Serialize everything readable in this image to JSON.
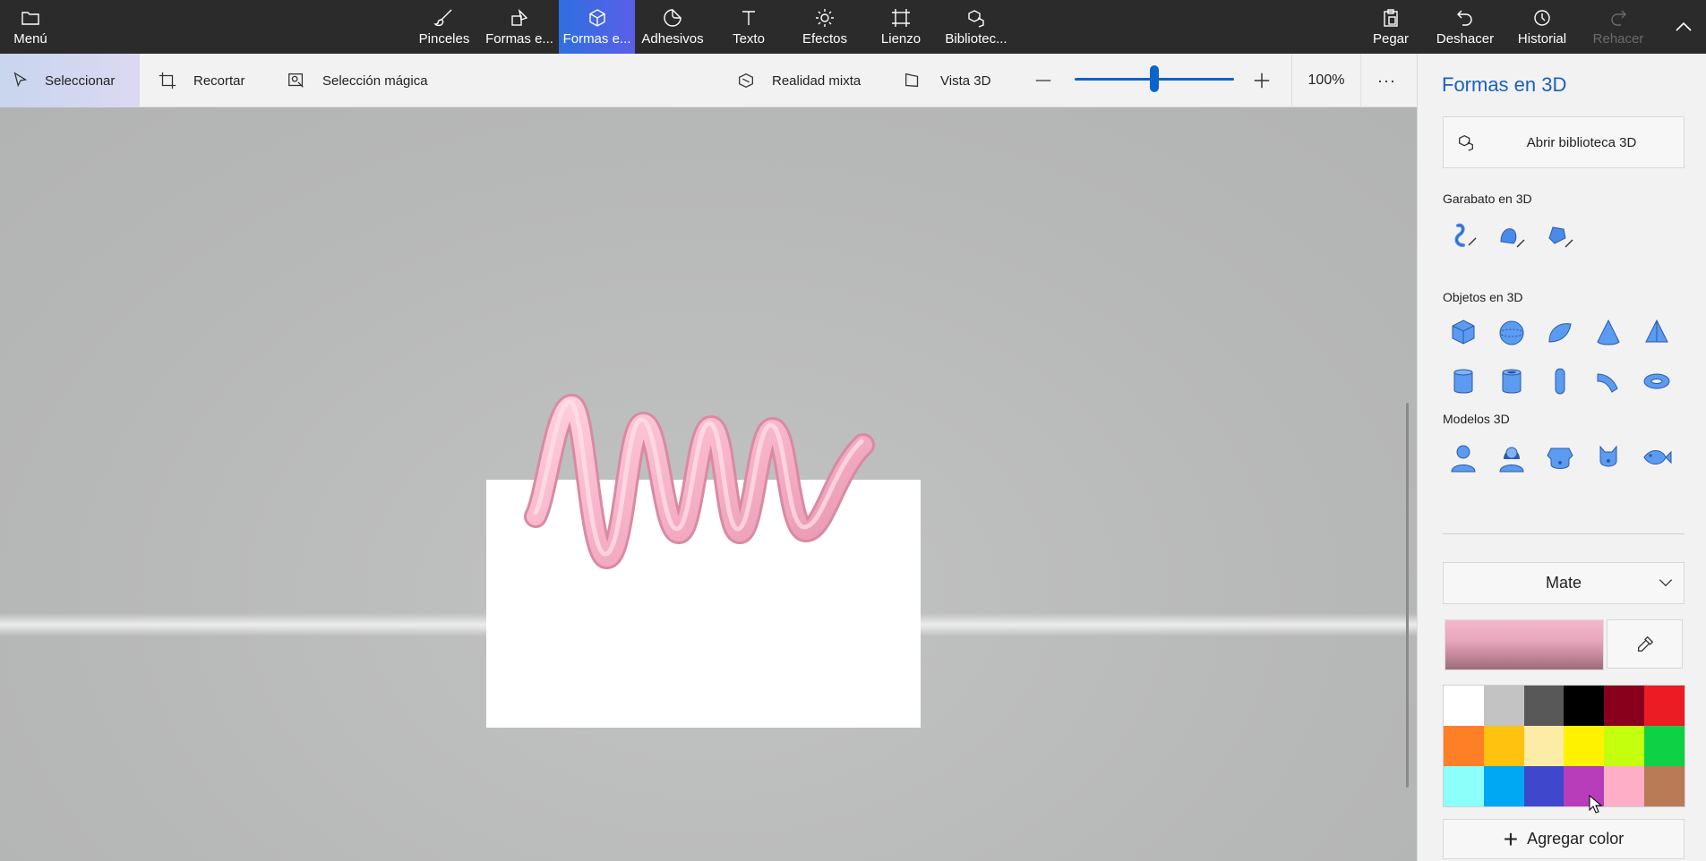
{
  "topbar": {
    "menu_label": "Menú",
    "tools": [
      {
        "label": "Pinceles",
        "icon": "brush-icon"
      },
      {
        "label": "Formas e...",
        "icon": "2d-shapes-icon"
      },
      {
        "label": "Formas e...",
        "icon": "3d-shapes-icon",
        "active": true
      },
      {
        "label": "Adhesivos",
        "icon": "stickers-icon"
      },
      {
        "label": "Texto",
        "icon": "text-icon"
      },
      {
        "label": "Efectos",
        "icon": "effects-icon"
      },
      {
        "label": "Lienzo",
        "icon": "canvas-icon"
      },
      {
        "label": "Bibliotec...",
        "icon": "3d-library-icon"
      }
    ],
    "actions": [
      {
        "label": "Pegar",
        "icon": "paste-icon"
      },
      {
        "label": "Deshacer",
        "icon": "undo-icon"
      },
      {
        "label": "Historial",
        "icon": "history-icon"
      },
      {
        "label": "Rehacer",
        "icon": "redo-icon",
        "disabled": true
      }
    ]
  },
  "toolbar2": {
    "select_label": "Seleccionar",
    "crop_label": "Recortar",
    "magic_select_label": "Selección mágica",
    "mixed_reality_label": "Realidad mixta",
    "view3d_label": "Vista 3D",
    "zoom_value": "100%",
    "zoom_fraction": 0.5,
    "more_label": "···"
  },
  "panel": {
    "title": "Formas en 3D",
    "open_library_label": "Abrir biblioteca 3D",
    "doodle_section": "Garabato en 3D",
    "objects_section": "Objetos en 3D",
    "models_section": "Modelos 3D",
    "material_value": "Mate",
    "add_color_label": "Agregar color",
    "selected_color": "#f4b7cc",
    "palette": [
      "#ffffff",
      "#c3c3c3",
      "#585858",
      "#000000",
      "#88001b",
      "#ec1c24",
      "#ff7f27",
      "#ffc20e",
      "#fdeca6",
      "#fff200",
      "#c4ff0e",
      "#0ed145",
      "#8cfffb",
      "#00a8f3",
      "#3f48cc",
      "#b83dba",
      "#ffaec8",
      "#b97a56"
    ]
  }
}
